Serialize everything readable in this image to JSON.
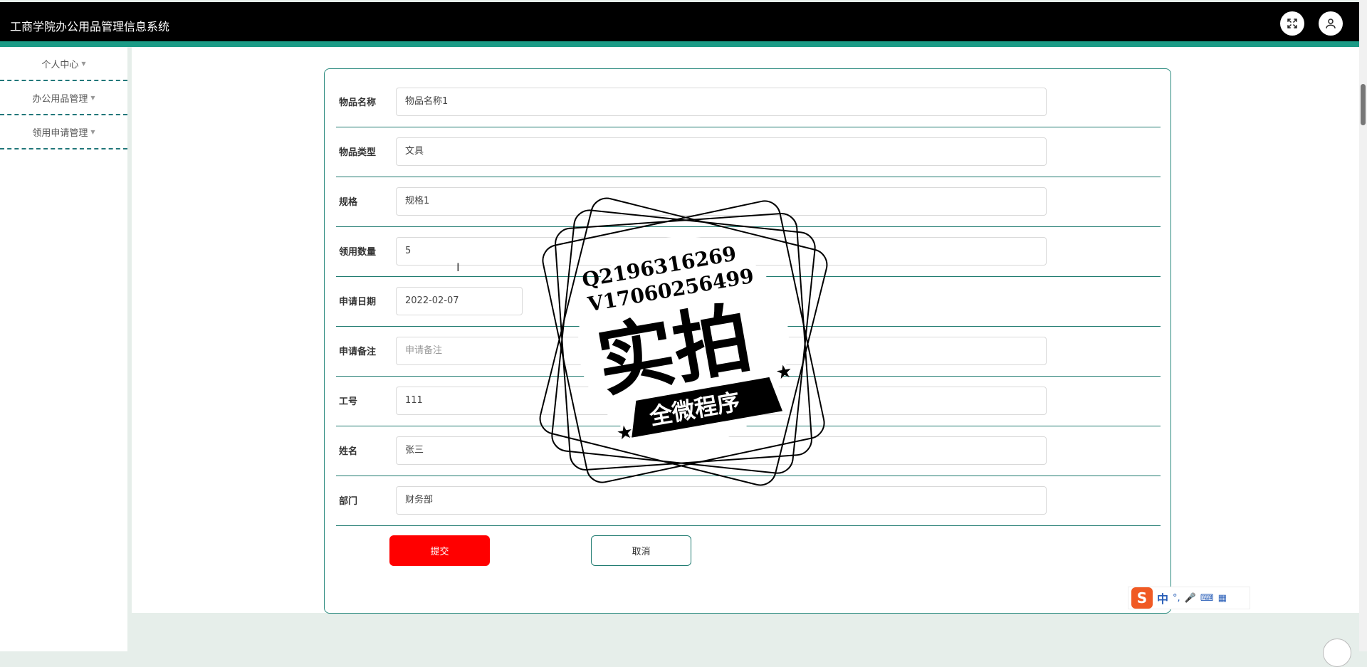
{
  "header": {
    "title": "工商学院办公用品管理信息系统",
    "fullscreen_icon": "expand-icon",
    "user_icon": "user-icon"
  },
  "sidebar": {
    "items": [
      {
        "label": "个人中心"
      },
      {
        "label": "办公用品管理"
      },
      {
        "label": "领用申请管理"
      }
    ]
  },
  "form": {
    "fields": [
      {
        "label": "物品名称",
        "value": "物品名称1",
        "placeholder": ""
      },
      {
        "label": "物品类型",
        "value": "文具",
        "placeholder": ""
      },
      {
        "label": "规格",
        "value": "规格1",
        "placeholder": ""
      },
      {
        "label": "领用数量",
        "value": "5",
        "placeholder": ""
      },
      {
        "label": "申请日期",
        "value": "2022-02-07",
        "placeholder": ""
      },
      {
        "label": "申请备注",
        "value": "",
        "placeholder": "申请备注"
      },
      {
        "label": "工号",
        "value": "111",
        "placeholder": ""
      },
      {
        "label": "姓名",
        "value": "张三",
        "placeholder": ""
      },
      {
        "label": "部门",
        "value": "财务部",
        "placeholder": ""
      }
    ],
    "submit_label": "提交",
    "cancel_label": "取消"
  },
  "watermark": {
    "line1": "Q2196316269",
    "line2": "V17060256499",
    "main": "实拍",
    "ribbon": "全微程序"
  },
  "ime": {
    "logo": "S",
    "mode": "中",
    "punct": "°,"
  },
  "colors": {
    "accent": "#1b9b86",
    "submit": "#ff0000",
    "header": "#000000"
  }
}
